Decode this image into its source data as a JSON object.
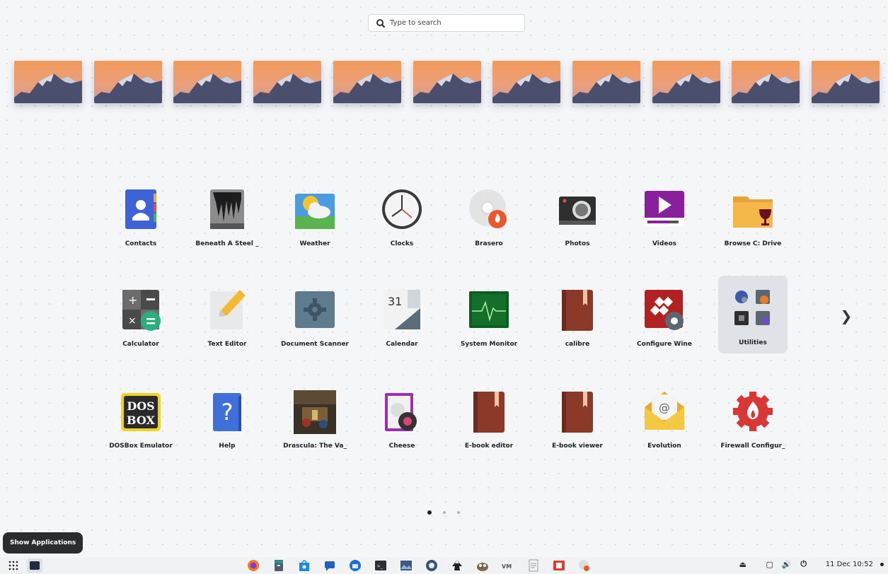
{
  "search": {
    "placeholder": "Type to search"
  },
  "workspaces": {
    "count": 11
  },
  "apps": [
    {
      "label": "Contacts",
      "icon": "contacts-icon"
    },
    {
      "label": "Beneath A Steel _",
      "icon": "beneath-a-steel-sky-icon"
    },
    {
      "label": "Weather",
      "icon": "weather-icon"
    },
    {
      "label": "Clocks",
      "icon": "clocks-icon"
    },
    {
      "label": "Brasero",
      "icon": "brasero-icon"
    },
    {
      "label": "Photos",
      "icon": "photos-icon"
    },
    {
      "label": "Videos",
      "icon": "videos-icon"
    },
    {
      "label": "Browse C: Drive",
      "icon": "wine-browse-drive-icon"
    },
    {
      "label": "Calculator",
      "icon": "calculator-icon"
    },
    {
      "label": "Text Editor",
      "icon": "text-editor-icon"
    },
    {
      "label": "Document Scanner",
      "icon": "document-scanner-icon"
    },
    {
      "label": "Calendar",
      "icon": "calendar-icon",
      "text": "31"
    },
    {
      "label": "System Monitor",
      "icon": "system-monitor-icon"
    },
    {
      "label": "calibre",
      "icon": "calibre-icon"
    },
    {
      "label": "Configure Wine",
      "icon": "configure-wine-icon"
    },
    {
      "label": "Utilities",
      "icon": "utilities-folder-icon",
      "selected": true
    },
    {
      "label": "DOSBox Emulator",
      "icon": "dosbox-icon",
      "text": "DOS BOX"
    },
    {
      "label": "Help",
      "icon": "help-icon",
      "text": "?"
    },
    {
      "label": "Drascula: The Va_",
      "icon": "drascula-icon"
    },
    {
      "label": "Cheese",
      "icon": "cheese-icon"
    },
    {
      "label": "E-book editor",
      "icon": "ebook-editor-icon"
    },
    {
      "label": "E-book viewer",
      "icon": "ebook-viewer-icon"
    },
    {
      "label": "Evolution",
      "icon": "evolution-icon"
    },
    {
      "label": "Firewall Configur_",
      "icon": "firewall-config-icon"
    }
  ],
  "pager": {
    "pages": 3,
    "current": 1
  },
  "tooltip": {
    "text": "Show Applications"
  },
  "taskbar": {
    "apps": [
      "firefox-icon",
      "file-manager-icon",
      "software-store-icon",
      "chat-icon",
      "thunderbird-icon",
      "terminal-icon",
      "image-viewer-icon",
      "aperture-icon",
      "inkscape-icon",
      "gimp-icon",
      "vm-icon",
      "document-icon",
      "presentation-icon",
      "brasero-icon"
    ],
    "tray": {
      "eject": "eject-icon",
      "window": "window-icon",
      "volume": "volume-icon",
      "power": "power-icon",
      "clock": "11 Dec 10:52"
    }
  },
  "colors": {
    "background": "#f5f6f8",
    "selected": "#dfe2e7",
    "tooltip": "#2b2c30"
  }
}
